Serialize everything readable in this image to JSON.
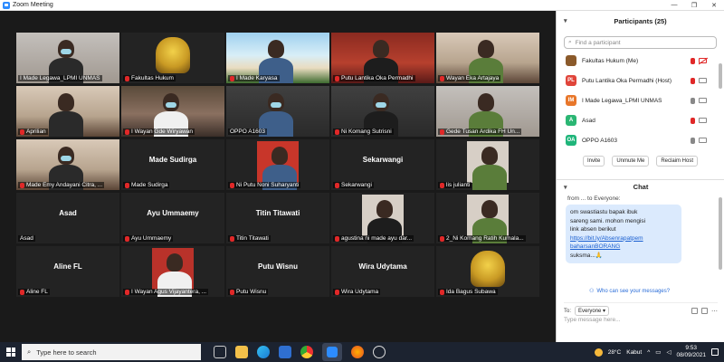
{
  "window": {
    "title": "Zoom Meeting",
    "min": "—",
    "max": "❐",
    "close": "✕"
  },
  "tiles": [
    {
      "name": "I Made Legawa_LPMI UNMAS",
      "center": "",
      "active": true,
      "muted": false
    },
    {
      "name": "Fakultas Hukum",
      "center": "",
      "muted": true
    },
    {
      "name": "I Made Karyasa",
      "center": "",
      "muted": true
    },
    {
      "name": "Putu Lantika Oka Permadhi",
      "center": "",
      "muted": true
    },
    {
      "name": "Wayan Eka Artajaya",
      "center": "",
      "muted": true
    },
    {
      "name": "Aprilian",
      "center": "",
      "muted": true
    },
    {
      "name": "I Wayan Gde Wiryawan",
      "center": "",
      "muted": true
    },
    {
      "name": "OPPO A1603",
      "center": "",
      "muted": false
    },
    {
      "name": "Ni Komang Sutrisni",
      "center": "",
      "muted": true
    },
    {
      "name": "Gede Tusan Ardika FH Un...",
      "center": "",
      "muted": true
    },
    {
      "name": "Made Emy Andayani Citra, ...",
      "center": "",
      "muted": true
    },
    {
      "name": "Made Sudirga",
      "center": "Made Sudirga",
      "muted": true
    },
    {
      "name": "Ni Putu Noni Suharyanti",
      "center": "",
      "muted": true
    },
    {
      "name": "Sekarwangi",
      "center": "Sekarwangi",
      "muted": true
    },
    {
      "name": "lis julianti",
      "center": "",
      "muted": true
    },
    {
      "name": "Asad",
      "center": "Asad",
      "muted": false
    },
    {
      "name": "Ayu Ummaemy",
      "center": "Ayu Ummaemy",
      "muted": true
    },
    {
      "name": "Titin Titawati",
      "center": "Titin Titawati",
      "muted": true
    },
    {
      "name": "agustina ni made ayu dar...",
      "center": "",
      "muted": true
    },
    {
      "name": "2_Ni Komang Ratih Kumala...",
      "center": "",
      "muted": true
    },
    {
      "name": "Aline FL",
      "center": "Aline FL",
      "muted": true
    },
    {
      "name": "I Wayan Agus Vijayantera, ...",
      "center": "",
      "muted": true
    },
    {
      "name": "Putu Wisnu",
      "center": "Putu Wisnu",
      "muted": true
    },
    {
      "name": "Wira Udytama",
      "center": "Wira Udytama",
      "muted": true
    },
    {
      "name": "Ida Bagus Subawa",
      "center": "",
      "muted": true
    }
  ],
  "participants": {
    "title": "Participants (25)",
    "search_placeholder": "Find a participant",
    "list": [
      {
        "initials": "",
        "name": "Fakultas Hukum (Me)",
        "color": "#8b5a2b",
        "mic": "off",
        "cam": "off"
      },
      {
        "initials": "PL",
        "name": "Putu Lantika Oka Permadhi (Host)",
        "color": "#e0453a",
        "mic": "off",
        "cam": "on"
      },
      {
        "initials": "IM",
        "name": "I Made Legawa_LPMI UNMAS",
        "color": "#e8772b",
        "mic": "on",
        "cam": "on"
      },
      {
        "initials": "A",
        "name": "Asad",
        "color": "#2bb673",
        "mic": "off",
        "cam": "on"
      },
      {
        "initials": "OA",
        "name": "OPPO A1603",
        "color": "#1fb57a",
        "mic": "on",
        "cam": "on"
      }
    ],
    "buttons": [
      "Invite",
      "Unmute Me",
      "Reclaim Host"
    ]
  },
  "chat": {
    "title": "Chat",
    "fragment": "from ... to Everyone:",
    "message_lines": [
      "om swastiastu bapak ibuk",
      "sareng sami. mohon mengisi",
      "link absen berikut"
    ],
    "link": "https://bit.ly/AbsenrapatpembaharsanBORANG",
    "link_display": [
      "https://bit.ly/Absenrapatpem",
      "baharsanBORANG"
    ],
    "closing": "suksma...🙏",
    "who_can_see": "Who can see your messages?",
    "to_label": "To:",
    "recipient": "Everyone",
    "input_placeholder": "Type message here..."
  },
  "taskbar": {
    "search_placeholder": "Type here to search",
    "weather_temp": "28°C",
    "weather_text": "Kabut",
    "time": "9:53",
    "date": "08/09/2021"
  },
  "colors": {
    "active_speaker": "#9ed04a",
    "muted": "#e02828",
    "link": "#1a5fd0",
    "zoom_blue": "#2d8cff"
  }
}
